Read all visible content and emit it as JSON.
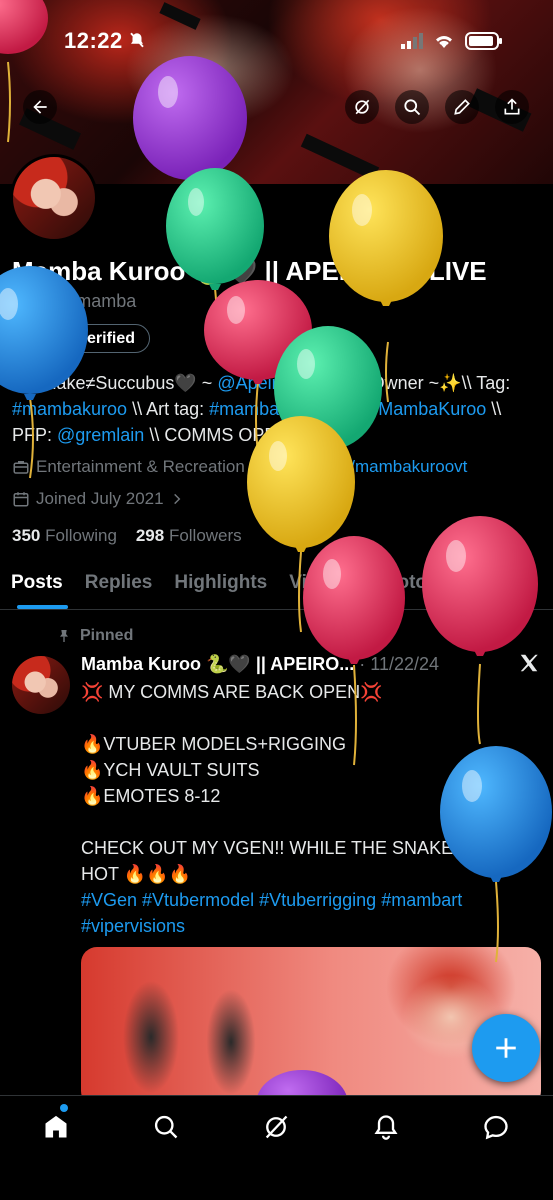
{
  "status_bar": {
    "time": "12:22"
  },
  "profile": {
    "name": "Mamba Kuroo 🐍🖤 || APEIRON ALIVE",
    "handle": "@itsjustmamba",
    "verify_label": "Get verified",
    "bio": {
      "part1": "🐍Snake≠Succubus🖤 ~ ",
      "mention1": "@ApeironAlive",
      "part2": " Co-Owner ~✨\\\\ Tag: ",
      "tag1": "#mambakuroo",
      "part3": " \\\\ Art tag: ",
      "tag2": "#mambart",
      "part4": " \\\\ ",
      "link1": "vgen.co/MambaKuroo",
      "part5": " \\\\ PFP: ",
      "mention2": "@gremlain",
      "part6": " \\\\ COMMS OPEN"
    },
    "category": "Entertainment & Recreation",
    "website": "twitch.tv/mambakuroovt",
    "joined": "Joined July 2021",
    "following_count": "350",
    "following_label": "Following",
    "followers_count": "298",
    "followers_label": "Followers"
  },
  "tabs": [
    "Posts",
    "Replies",
    "Highlights",
    "Videos",
    "Photos",
    "Articles"
  ],
  "post": {
    "pinned_label": "Pinned",
    "author": "Mamba Kuroo 🐍🖤 || APEIRO...",
    "date": "· 11/22/24",
    "lines": [
      "💢 MY COMMS ARE BACK OPEN💢",
      "",
      "🔥VTUBER MODELS+RIGGING",
      "🔥YCH VAULT SUITS",
      "🔥EMOTES 8-12",
      "",
      "CHECK OUT MY VGEN!! WHILE THE SNAKE PIT IS HOT 🔥🔥🔥"
    ],
    "hashtags": "#VGen #Vtubermodel #Vtuberrigging #mambart #vipervisions"
  },
  "colors": {
    "accent": "#1d9bf0",
    "muted": "#71767b",
    "background": "#000000"
  },
  "icons": [
    "back-arrow-icon",
    "grok-icon",
    "search-icon",
    "edit-icon",
    "share-icon",
    "verified-badge-icon",
    "briefcase-icon",
    "link-icon",
    "calendar-icon",
    "pin-icon",
    "x-logo-icon",
    "plus-icon",
    "home-icon",
    "explore-icon",
    "grok-nav-icon",
    "notifications-icon",
    "messages-icon"
  ]
}
